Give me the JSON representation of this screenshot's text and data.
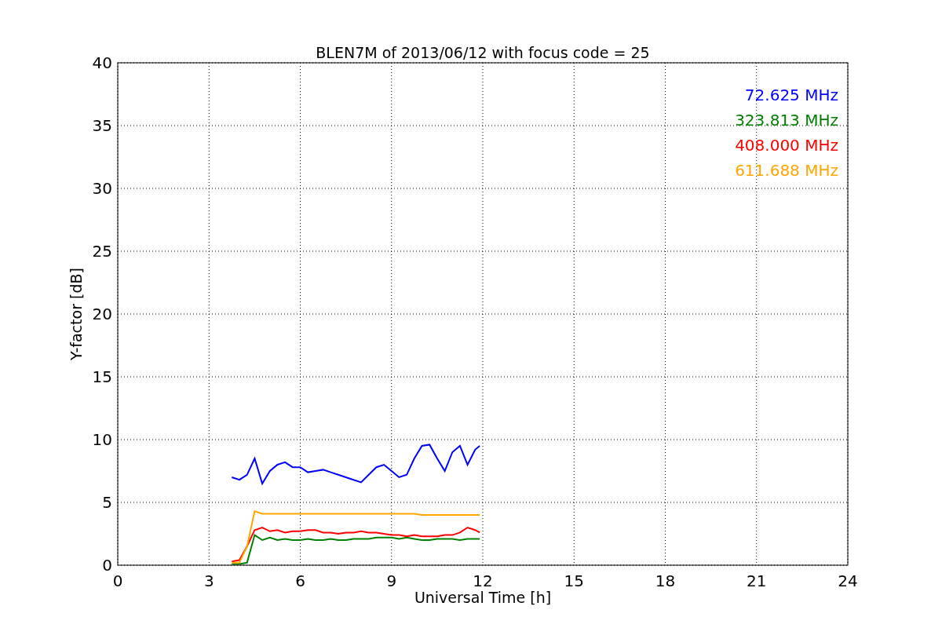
{
  "chart_data": {
    "type": "line",
    "title": "BLEN7M of 2013/06/12 with focus code = 25",
    "xlabel": "Universal Time [h]",
    "ylabel": "Y-factor [dB]",
    "x": [
      3.75,
      4,
      4.25,
      4.5,
      4.75,
      5,
      5.25,
      5.5,
      5.75,
      6,
      6.25,
      6.5,
      6.75,
      7,
      7.25,
      7.5,
      7.75,
      8,
      8.25,
      8.5,
      8.75,
      9,
      9.25,
      9.5,
      9.75,
      10,
      10.25,
      10.5,
      10.75,
      11,
      11.25,
      11.5,
      11.75,
      11.9
    ],
    "grid": true,
    "xlim": [
      0,
      24
    ],
    "ylim": [
      0,
      40
    ],
    "xticks": [
      0,
      3,
      6,
      9,
      12,
      15,
      18,
      21,
      24
    ],
    "yticks": [
      0,
      5,
      10,
      15,
      20,
      25,
      30,
      35,
      40
    ],
    "series": [
      {
        "name": "72.625 MHz",
        "color": "#0000ff",
        "values": [
          7.0,
          6.8,
          7.2,
          8.5,
          6.5,
          7.5,
          8.0,
          8.2,
          7.8,
          7.8,
          7.4,
          7.5,
          7.6,
          7.4,
          7.2,
          7.0,
          6.8,
          6.6,
          7.2,
          7.8,
          8.0,
          7.5,
          7.0,
          7.2,
          8.5,
          9.5,
          9.6,
          8.5,
          7.5,
          9.0,
          9.5,
          8.0,
          9.2,
          9.5
        ]
      },
      {
        "name": "323.813 MHz",
        "color": "#008000",
        "values": [
          0.1,
          0.1,
          0.2,
          2.4,
          2.0,
          2.2,
          2.0,
          2.1,
          2.0,
          2.0,
          2.1,
          2.0,
          2.0,
          2.1,
          2.0,
          2.0,
          2.1,
          2.1,
          2.1,
          2.2,
          2.2,
          2.2,
          2.1,
          2.2,
          2.1,
          2.0,
          2.0,
          2.1,
          2.1,
          2.1,
          2.0,
          2.1,
          2.1,
          2.1
        ]
      },
      {
        "name": "408.000 MHz",
        "color": "#ff0000",
        "values": [
          0.3,
          0.4,
          1.5,
          2.8,
          3.0,
          2.7,
          2.8,
          2.6,
          2.7,
          2.7,
          2.8,
          2.8,
          2.6,
          2.6,
          2.5,
          2.6,
          2.6,
          2.7,
          2.6,
          2.6,
          2.5,
          2.4,
          2.4,
          2.3,
          2.4,
          2.3,
          2.3,
          2.3,
          2.4,
          2.4,
          2.6,
          3.0,
          2.8,
          2.6
        ]
      },
      {
        "name": "611.688 MHz",
        "color": "#ffa500",
        "values": [
          0.2,
          0.2,
          1.5,
          4.3,
          4.1,
          4.1,
          4.1,
          4.1,
          4.1,
          4.1,
          4.1,
          4.1,
          4.1,
          4.1,
          4.1,
          4.1,
          4.1,
          4.1,
          4.1,
          4.1,
          4.1,
          4.1,
          4.1,
          4.1,
          4.1,
          4.0,
          4.0,
          4.0,
          4.0,
          4.0,
          4.0,
          4.0,
          4.0,
          4.0
        ]
      }
    ]
  }
}
